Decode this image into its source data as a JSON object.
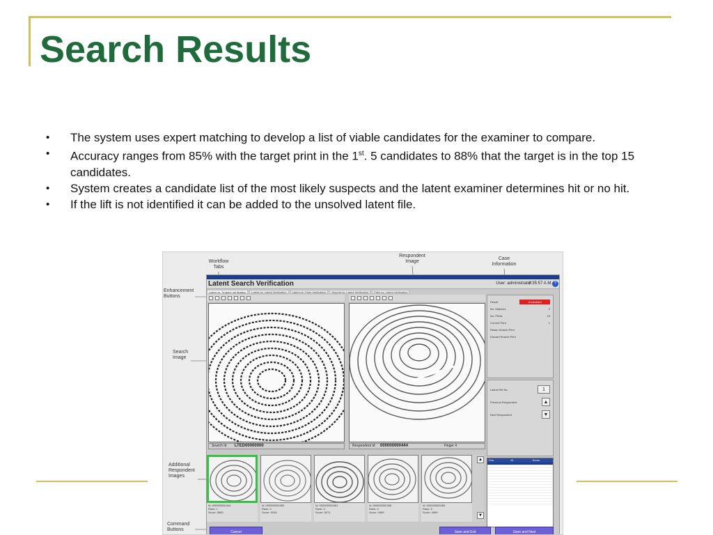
{
  "slide": {
    "title": "Search Results",
    "bullets": [
      "The system uses expert matching to develop a list of viable candidates for the examiner to compare.",
      "Accuracy ranges from 85% with the target print in the 1",
      "st",
      ". 5 candidates to 88% that the target is in the top 15 candidates.",
      "System creates a candidate list of the most likely suspects and the latent examiner determines hit or no hit.",
      "If the lift is not identified it can be added to the unsolved latent file."
    ]
  },
  "colors": {
    "title": "#1f6b3c",
    "rule": "#d6bf5a",
    "command_button": "#6d5fd6",
    "selected_thumb": "#35c243",
    "result_badge": "#e02020"
  },
  "annotations": {
    "workflow_tabs": "Workflow Tabs",
    "respondent_image": "Respondent Image",
    "case_information": "Case Information",
    "enhancement_buttons": "Enhancement Buttons",
    "search_image": "Search Image",
    "additional_respondent_images": "Additional Respondent Images",
    "command_buttons": "Command Buttons"
  },
  "app": {
    "title_bar": "Latent Search Verification",
    "user": "User: administrator",
    "time": "8:35:57 A.M.",
    "help": "?",
    "tabs": [
      "Latent vs. Tenprint Verification",
      "Latent vs. Latent Verification",
      "Latent vs. Palm Verification",
      "Tenprint vs. Latent Verification",
      "Palm vs. Latent Verification"
    ],
    "search_label": "Search Id",
    "search_id": "LTED00000000",
    "respondent_label": "Respondent Id",
    "respondent_id": "000000000444",
    "finger_label": "Finger",
    "finger_value": "4",
    "case": {
      "result_label": "Result",
      "result_value": "Undecided",
      "rows": [
        {
          "label": "No. Matches",
          "value": "0"
        },
        {
          "label": "No. Prints",
          "value": "15"
        },
        {
          "label": "Current Print",
          "value": "1"
        }
      ],
      "options": [
        "Retain Search Print",
        "Discard Search Print"
      ]
    },
    "nav": {
      "latent_ref_label": "Latent Ref No.",
      "latent_ref_value": "1",
      "previous": "Previous Respondent",
      "next": "Next Respondent"
    },
    "candidate_table": {
      "columns": [
        "Pos",
        "ID",
        "Score"
      ]
    },
    "thumbs": [
      {
        "id": "Id: 000000000444",
        "rank": "Rank: 1",
        "score": "Score: 5560"
      },
      {
        "id": "Id: 000000000450",
        "rank": "Rank: 2",
        "score": "Score: 5246"
      },
      {
        "id": "Id: 000000000461",
        "rank": "Rank: 3",
        "score": "Score: 5071"
      },
      {
        "id": "Id: 000000000438",
        "rank": "Rank: 4",
        "score": "Score: 4989"
      },
      {
        "id": "Id: 000000000455",
        "rank": "Rank: 5",
        "score": "Score: 4969"
      }
    ],
    "commands": {
      "cancel": "Cancel",
      "save_exit": "Save and Exit",
      "save_next": "Save and Next"
    }
  }
}
